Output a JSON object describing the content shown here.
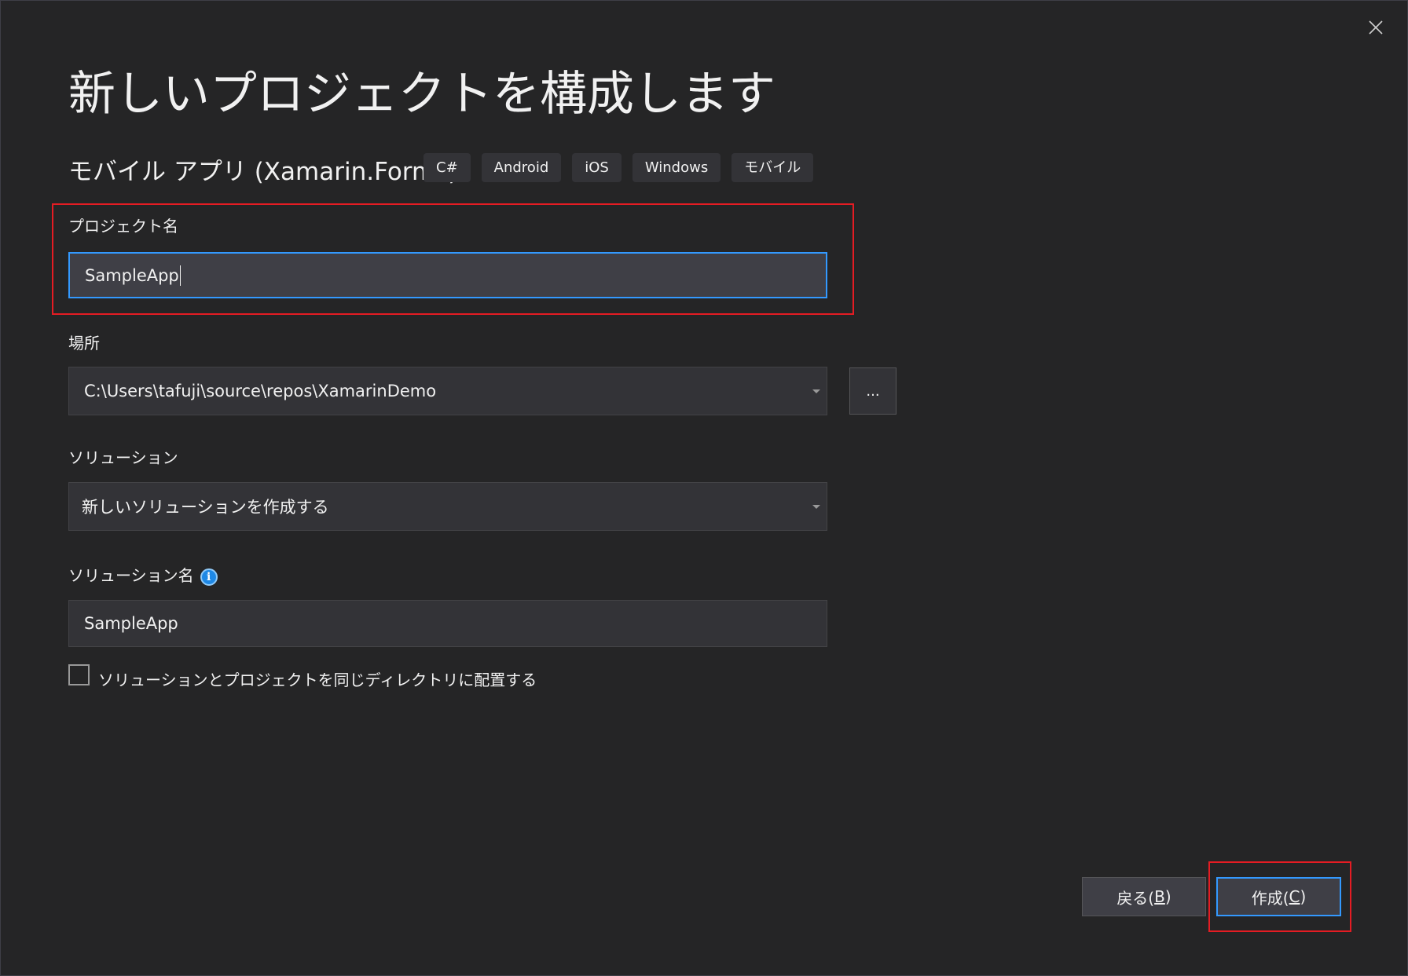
{
  "dialog": {
    "title": "新しいプロジェクトを構成します",
    "template_name": "モバイル アプリ (Xamarin.Forms)",
    "tags": [
      "C#",
      "Android",
      "iOS",
      "Windows",
      "モバイル"
    ]
  },
  "project_name": {
    "label": "プロジェクト名",
    "value": "SampleApp"
  },
  "location": {
    "label": "場所",
    "value": "C:\\Users\\tafuji\\source\\repos\\XamarinDemo",
    "browse_label": "..."
  },
  "solution": {
    "label": "ソリューション",
    "value": "新しいソリューションを作成する"
  },
  "solution_name": {
    "label": "ソリューション名",
    "info_glyph": "i",
    "value": "SampleApp"
  },
  "same_directory": {
    "label": "ソリューションとプロジェクトを同じディレクトリに配置する",
    "checked": false
  },
  "buttons": {
    "back_text": "戻る(",
    "back_key": "B",
    "back_end": ")",
    "create_text": "作成(",
    "create_key": "C",
    "create_end": ")"
  },
  "colors": {
    "background": "#252526",
    "field": "#333337",
    "focus_border": "#3399ff",
    "highlight": "#e51c23",
    "info_icon": "#1e88e5"
  }
}
